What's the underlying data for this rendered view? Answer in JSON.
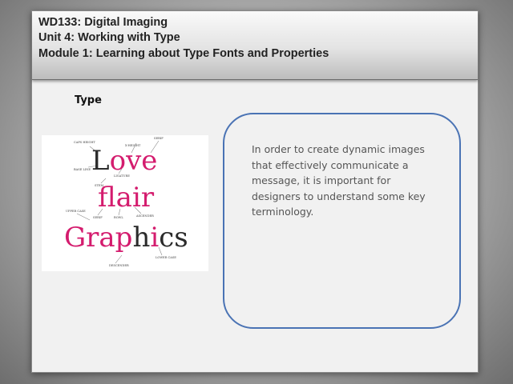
{
  "header": {
    "line1": "WD133: Digital Imaging",
    "line2": "Unit 4: Working with Type",
    "line3": "Module 1: Learning about Type Fonts and Properties"
  },
  "content": {
    "subtitle": "Type",
    "body_text": "In order to create dynamic images that effectively communicate a message, it is important for designers to understand some key terminology."
  },
  "figure": {
    "words": {
      "love_L": "L",
      "love_o": "o",
      "love_ve": "ve",
      "flair": "flair",
      "graphics_Grap": "Grap",
      "graphics_h": "h",
      "graphics_i": "i",
      "graphics_cs": "cs"
    },
    "labels": [
      "CAPS HEIGHT",
      "X-HEIGHT",
      "SERIF",
      "BASE LINE",
      "LIGATURE",
      "STEM",
      "UPPER CASE",
      "SERIF",
      "BOWL",
      "ASCENDER",
      "LOWER CASE",
      "DESCENDER"
    ],
    "colors": {
      "dark": "#2b2b2b",
      "accent": "#d41c6e"
    }
  }
}
